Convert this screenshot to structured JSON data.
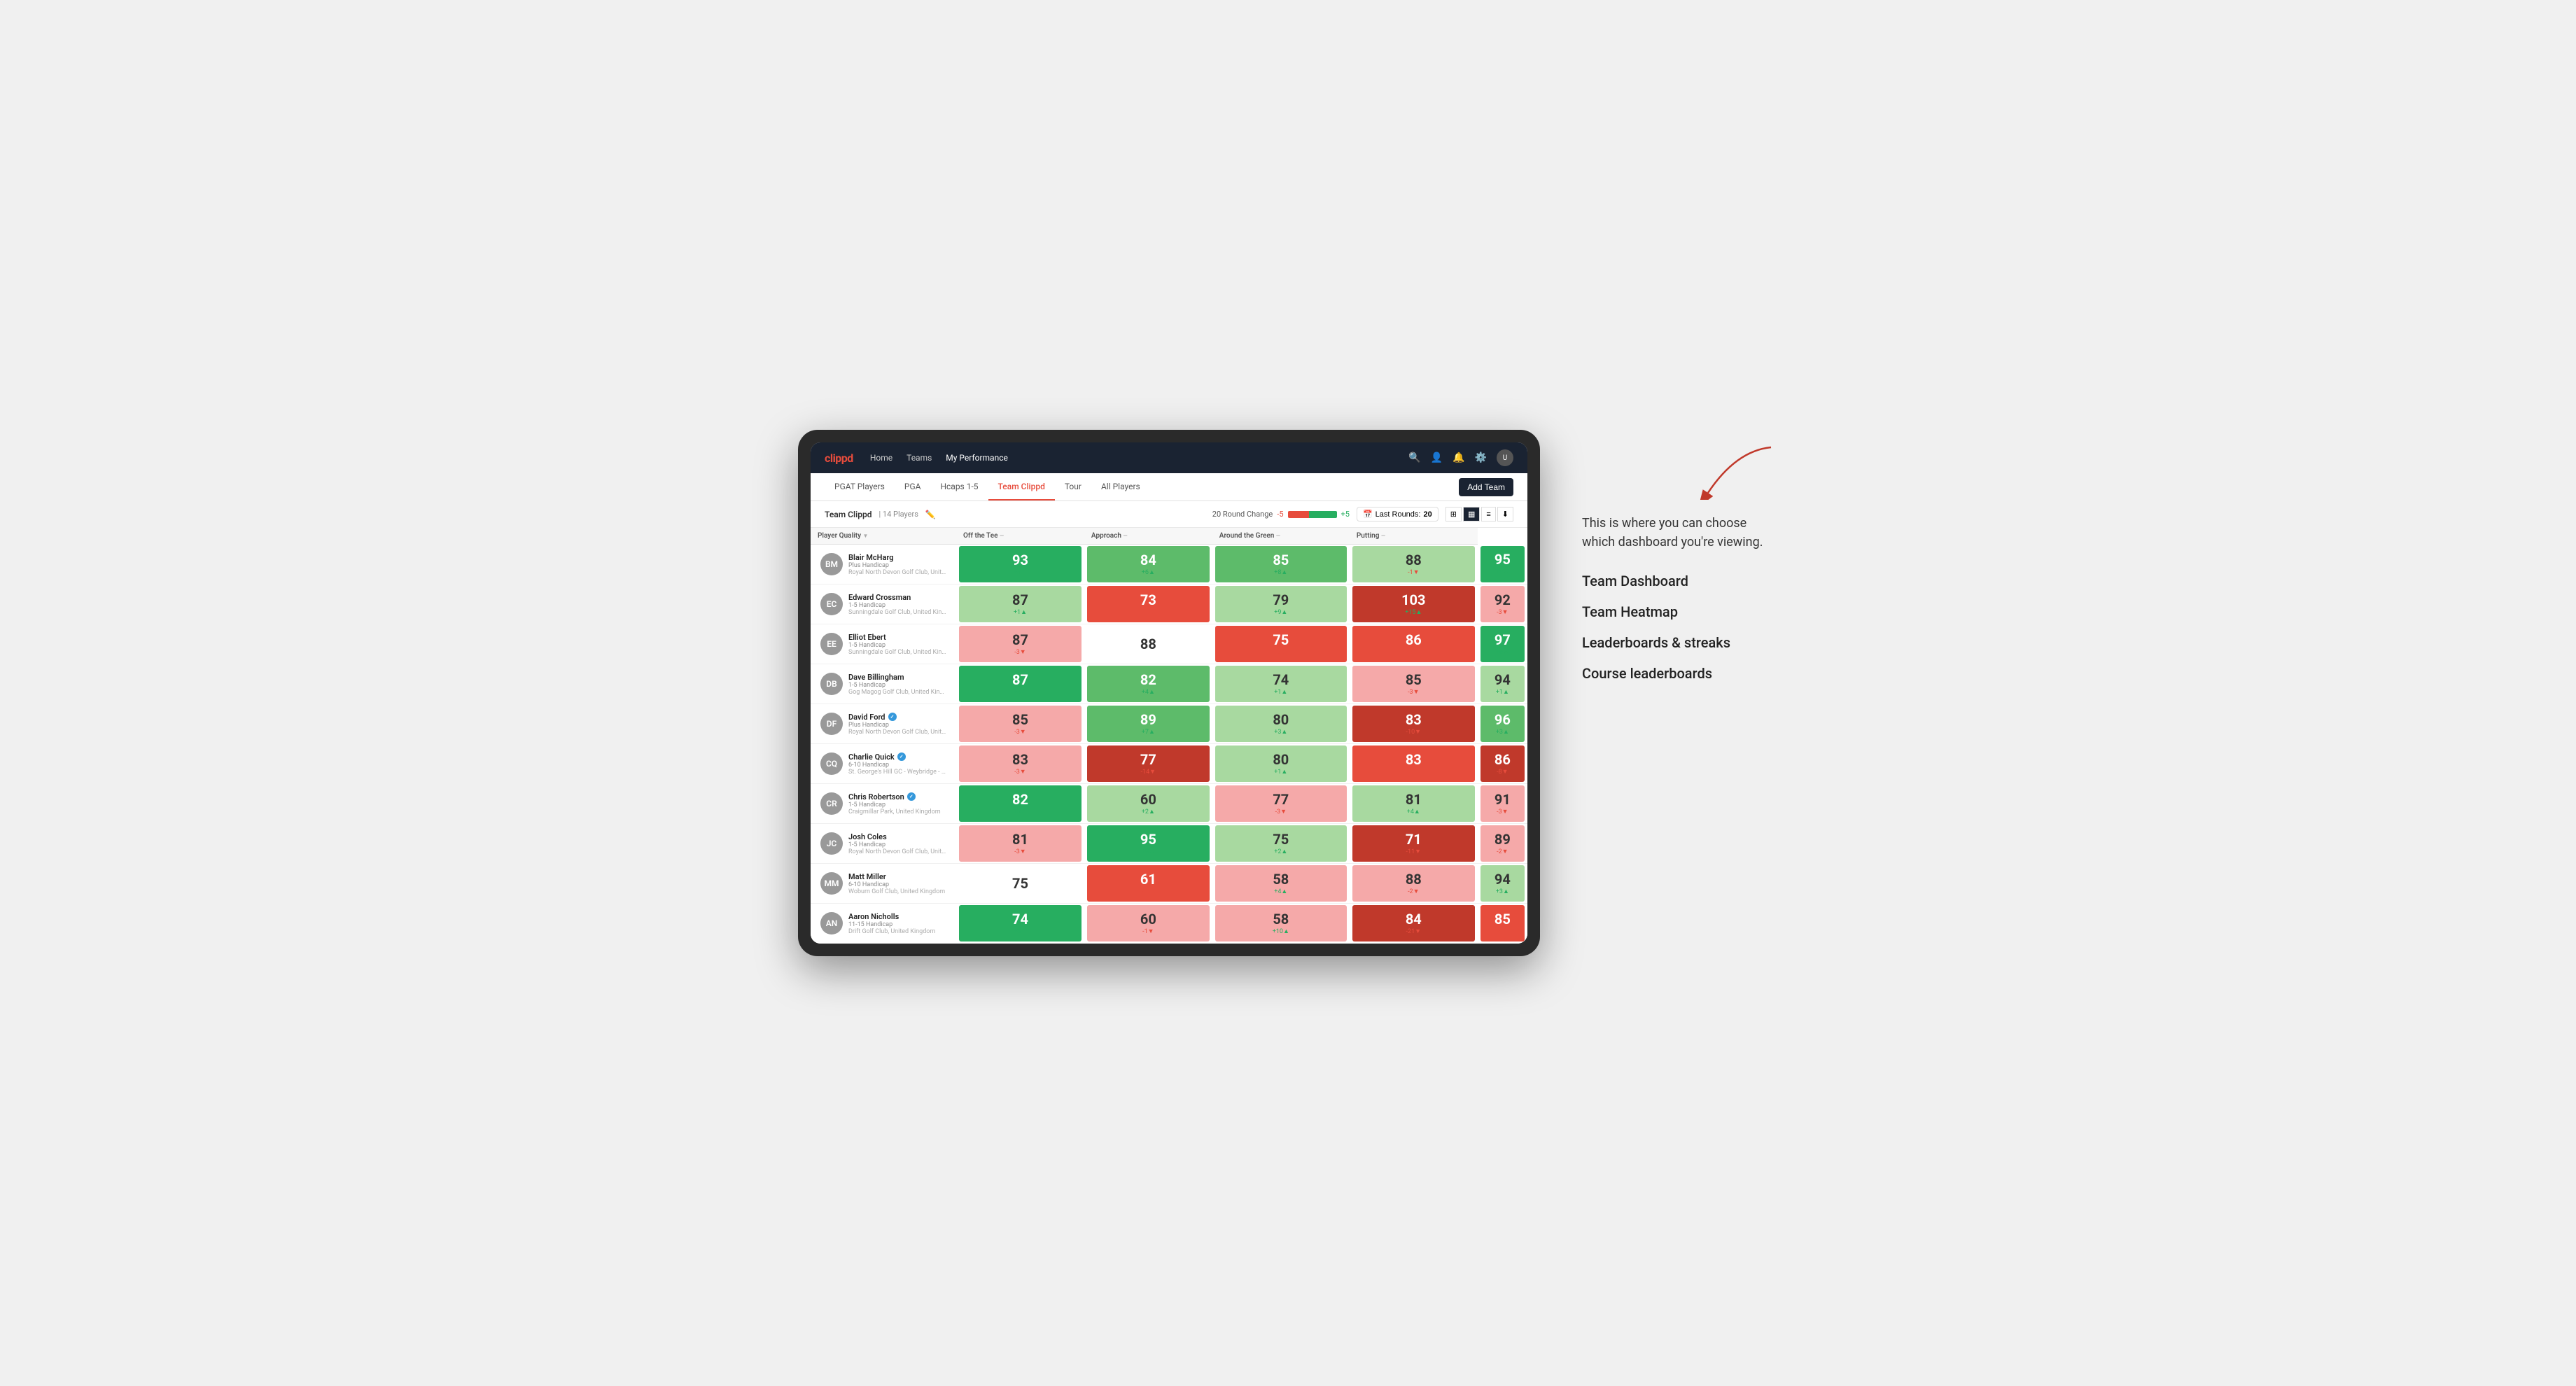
{
  "app": {
    "logo": "clippd",
    "nav": {
      "items": [
        {
          "label": "Home",
          "active": false
        },
        {
          "label": "Teams",
          "active": false
        },
        {
          "label": "My Performance",
          "active": true
        }
      ]
    }
  },
  "sub_nav": {
    "items": [
      {
        "label": "PGAT Players",
        "active": false
      },
      {
        "label": "PGA",
        "active": false
      },
      {
        "label": "Hcaps 1-5",
        "active": false
      },
      {
        "label": "Team Clippd",
        "active": true
      },
      {
        "label": "Tour",
        "active": false
      },
      {
        "label": "All Players",
        "active": false
      }
    ],
    "add_team_label": "Add Team"
  },
  "team_bar": {
    "title": "Team Clippd",
    "separator": "|",
    "player_count": "14 Players",
    "round_change_label": "20 Round Change",
    "round_neg": "-5",
    "round_pos": "+5",
    "last_rounds_label": "Last Rounds:",
    "last_rounds_value": "20"
  },
  "table": {
    "columns": [
      {
        "label": "Player Quality",
        "key": "quality"
      },
      {
        "label": "Off the Tee",
        "key": "tee"
      },
      {
        "label": "Approach",
        "key": "approach"
      },
      {
        "label": "Around the Green",
        "key": "around"
      },
      {
        "label": "Putting",
        "key": "putting"
      }
    ],
    "rows": [
      {
        "name": "Blair McHarg",
        "handicap": "Plus Handicap",
        "club": "Royal North Devon Golf Club, United Kingdom",
        "avatar_color": "av-brown",
        "avatar_initials": "BM",
        "verified": false,
        "quality": {
          "value": 93,
          "change": "+4",
          "dir": "up",
          "bg": "bg-green-dark"
        },
        "tee": {
          "value": 84,
          "change": "+6",
          "dir": "up",
          "bg": "bg-green-mid"
        },
        "approach": {
          "value": 85,
          "change": "+8",
          "dir": "up",
          "bg": "bg-green-mid"
        },
        "around": {
          "value": 88,
          "change": "-1",
          "dir": "down",
          "bg": "bg-green-light"
        },
        "putting": {
          "value": 95,
          "change": "+9",
          "dir": "up",
          "bg": "bg-green-dark"
        }
      },
      {
        "name": "Edward Crossman",
        "handicap": "1-5 Handicap",
        "club": "Sunningdale Golf Club, United Kingdom",
        "avatar_color": "av-gray",
        "avatar_initials": "EC",
        "verified": false,
        "quality": {
          "value": 87,
          "change": "+1",
          "dir": "up",
          "bg": "bg-green-light"
        },
        "tee": {
          "value": 73,
          "change": "-11",
          "dir": "down",
          "bg": "bg-red-mid"
        },
        "approach": {
          "value": 79,
          "change": "+9",
          "dir": "up",
          "bg": "bg-green-light"
        },
        "around": {
          "value": 103,
          "change": "+15",
          "dir": "up",
          "bg": "bg-red-dark"
        },
        "putting": {
          "value": 92,
          "change": "-3",
          "dir": "down",
          "bg": "bg-red-light"
        }
      },
      {
        "name": "Elliot Ebert",
        "handicap": "1-5 Handicap",
        "club": "Sunningdale Golf Club, United Kingdom",
        "avatar_color": "av-navy",
        "avatar_initials": "EE",
        "verified": false,
        "quality": {
          "value": 87,
          "change": "-3",
          "dir": "down",
          "bg": "bg-red-light"
        },
        "tee": {
          "value": 88,
          "change": "",
          "dir": "none",
          "bg": "bg-white"
        },
        "approach": {
          "value": 75,
          "change": "-3",
          "dir": "down",
          "bg": "bg-red-mid"
        },
        "around": {
          "value": 86,
          "change": "-6",
          "dir": "down",
          "bg": "bg-red-mid"
        },
        "putting": {
          "value": 97,
          "change": "+5",
          "dir": "up",
          "bg": "bg-green-dark"
        }
      },
      {
        "name": "Dave Billingham",
        "handicap": "1-5 Handicap",
        "club": "Gog Magog Golf Club, United Kingdom",
        "avatar_color": "av-blue",
        "avatar_initials": "DB",
        "verified": false,
        "quality": {
          "value": 87,
          "change": "+4",
          "dir": "up",
          "bg": "bg-green-dark"
        },
        "tee": {
          "value": 82,
          "change": "+4",
          "dir": "up",
          "bg": "bg-green-mid"
        },
        "approach": {
          "value": 74,
          "change": "+1",
          "dir": "up",
          "bg": "bg-green-light"
        },
        "around": {
          "value": 85,
          "change": "-3",
          "dir": "down",
          "bg": "bg-red-light"
        },
        "putting": {
          "value": 94,
          "change": "+1",
          "dir": "up",
          "bg": "bg-green-light"
        }
      },
      {
        "name": "David Ford",
        "handicap": "Plus Handicap",
        "club": "Royal North Devon Golf Club, United Kingdom",
        "avatar_color": "av-teal",
        "avatar_initials": "DF",
        "verified": true,
        "quality": {
          "value": 85,
          "change": "-3",
          "dir": "down",
          "bg": "bg-red-light"
        },
        "tee": {
          "value": 89,
          "change": "+7",
          "dir": "up",
          "bg": "bg-green-mid"
        },
        "approach": {
          "value": 80,
          "change": "+3",
          "dir": "up",
          "bg": "bg-green-light"
        },
        "around": {
          "value": 83,
          "change": "-10",
          "dir": "down",
          "bg": "bg-red-dark"
        },
        "putting": {
          "value": 96,
          "change": "+3",
          "dir": "up",
          "bg": "bg-green-mid"
        }
      },
      {
        "name": "Charlie Quick",
        "handicap": "6-10 Handicap",
        "club": "St. George's Hill GC - Weybridge - Surrey, Uni...",
        "avatar_color": "av-orange",
        "avatar_initials": "CQ",
        "verified": true,
        "quality": {
          "value": 83,
          "change": "-3",
          "dir": "down",
          "bg": "bg-red-light"
        },
        "tee": {
          "value": 77,
          "change": "-14",
          "dir": "down",
          "bg": "bg-red-dark"
        },
        "approach": {
          "value": 80,
          "change": "+1",
          "dir": "up",
          "bg": "bg-green-light"
        },
        "around": {
          "value": 83,
          "change": "-6",
          "dir": "down",
          "bg": "bg-red-mid"
        },
        "putting": {
          "value": 86,
          "change": "-8",
          "dir": "down",
          "bg": "bg-red-dark"
        }
      },
      {
        "name": "Chris Robertson",
        "handicap": "1-5 Handicap",
        "club": "Craigmillar Park, United Kingdom",
        "avatar_color": "av-purple",
        "avatar_initials": "CR",
        "verified": true,
        "quality": {
          "value": 82,
          "change": "+3",
          "dir": "up",
          "bg": "bg-green-dark"
        },
        "tee": {
          "value": 60,
          "change": "+2",
          "dir": "up",
          "bg": "bg-green-light"
        },
        "approach": {
          "value": 77,
          "change": "-3",
          "dir": "down",
          "bg": "bg-red-light"
        },
        "around": {
          "value": 81,
          "change": "+4",
          "dir": "up",
          "bg": "bg-green-light"
        },
        "putting": {
          "value": 91,
          "change": "-3",
          "dir": "down",
          "bg": "bg-red-light"
        }
      },
      {
        "name": "Josh Coles",
        "handicap": "1-5 Handicap",
        "club": "Royal North Devon Golf Club, United Kingdom",
        "avatar_color": "av-red",
        "avatar_initials": "JC",
        "verified": false,
        "quality": {
          "value": 81,
          "change": "-3",
          "dir": "down",
          "bg": "bg-red-light"
        },
        "tee": {
          "value": 95,
          "change": "+8",
          "dir": "up",
          "bg": "bg-green-dark"
        },
        "approach": {
          "value": 75,
          "change": "+2",
          "dir": "up",
          "bg": "bg-green-light"
        },
        "around": {
          "value": 71,
          "change": "-11",
          "dir": "down",
          "bg": "bg-red-dark"
        },
        "putting": {
          "value": 89,
          "change": "-2",
          "dir": "down",
          "bg": "bg-red-light"
        }
      },
      {
        "name": "Matt Miller",
        "handicap": "6-10 Handicap",
        "club": "Woburn Golf Club, United Kingdom",
        "avatar_color": "av-dark",
        "avatar_initials": "MM",
        "verified": false,
        "quality": {
          "value": 75,
          "change": "",
          "dir": "none",
          "bg": "bg-white"
        },
        "tee": {
          "value": 61,
          "change": "-3",
          "dir": "down",
          "bg": "bg-red-mid"
        },
        "approach": {
          "value": 58,
          "change": "+4",
          "dir": "up",
          "bg": "bg-red-light"
        },
        "around": {
          "value": 88,
          "change": "-2",
          "dir": "down",
          "bg": "bg-red-light"
        },
        "putting": {
          "value": 94,
          "change": "+3",
          "dir": "up",
          "bg": "bg-green-light"
        }
      },
      {
        "name": "Aaron Nicholls",
        "handicap": "11-15 Handicap",
        "club": "Drift Golf Club, United Kingdom",
        "avatar_color": "av-green",
        "avatar_initials": "AN",
        "verified": false,
        "quality": {
          "value": 74,
          "change": "+8",
          "dir": "up",
          "bg": "bg-green-dark"
        },
        "tee": {
          "value": 60,
          "change": "-1",
          "dir": "down",
          "bg": "bg-red-light"
        },
        "approach": {
          "value": 58,
          "change": "+10",
          "dir": "up",
          "bg": "bg-red-light"
        },
        "around": {
          "value": 84,
          "change": "-21",
          "dir": "down",
          "bg": "bg-red-dark"
        },
        "putting": {
          "value": 85,
          "change": "-4",
          "dir": "down",
          "bg": "bg-red-mid"
        }
      }
    ]
  },
  "annotation": {
    "text": "This is where you can choose which dashboard you're viewing.",
    "items": [
      {
        "label": "Team Dashboard"
      },
      {
        "label": "Team Heatmap"
      },
      {
        "label": "Leaderboards & streaks"
      },
      {
        "label": "Course leaderboards"
      }
    ]
  }
}
